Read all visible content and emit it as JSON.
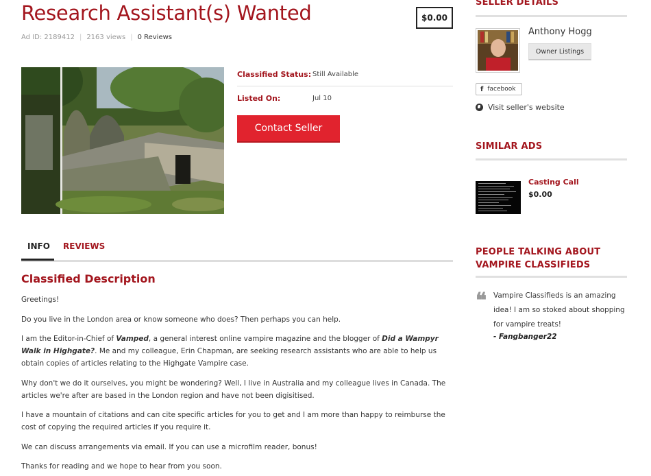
{
  "listing": {
    "title": "Research Assistant(s) Wanted",
    "price": "$0.00",
    "ad_id": "Ad ID: 2189412",
    "views": "2163 views",
    "reviews": "0 Reviews",
    "status_label": "Classified Status:",
    "status_value": "Still Available",
    "listed_label": "Listed On:",
    "listed_value": "Jul 10",
    "contact_label": "Contact Seller"
  },
  "tabs": {
    "info": "INFO",
    "reviews": "REVIEWS"
  },
  "description": {
    "heading": "Classified Description",
    "greeting": "Greetings!",
    "p1": "Do you live in the London area or know someone who does? Then perhaps you can help.",
    "p2_a": "I am the Editor-in-Chief of ",
    "p2_vamped": "Vamped",
    "p2_b": ", a general interest online vampire magazine and the blogger of ",
    "p2_blog": "Did a Wampyr Walk in Highgate?",
    "p2_c": ". Me and my colleague, Erin Chapman, are seeking research assistants who are able to help us obtain copies of articles relating to the Highgate Vampire case.",
    "p3": "Why don't we do it ourselves, you might be wondering? Well, I live in Australia and my colleague lives in Canada. The articles we're after are based in the London region and have not been digisitised.",
    "p4": "I have a mountain of citations and can cite specific articles for you to get and I am more than happy to reimburse the cost of copying the required articles if you require it.",
    "p5": "We can discuss arrangements via email. If you can use a microfilm reader, bonus!",
    "p6": "Thanks for reading and we hope to hear from you soon."
  },
  "sidebar": {
    "seller_heading": "SELLER DETAILS",
    "seller_name": "Anthony Hogg",
    "owner_listings": "Owner Listings",
    "facebook": "facebook",
    "website": "Visit seller's website",
    "similar_heading": "SIMILAR ADS",
    "similar_title": "Casting Call",
    "similar_price": "$0.00",
    "people_heading_1": "PEOPLE TALKING ABOUT",
    "people_heading_2": "VAMPIRE CLASSIFIEDS",
    "quote": "Vampire Classifieds is an amazing idea! I am so stoked about shopping for vampire treats!",
    "quote_author": "- Fangbanger22"
  },
  "colors": {
    "accent": "#a3161e",
    "button": "#e1232e"
  }
}
